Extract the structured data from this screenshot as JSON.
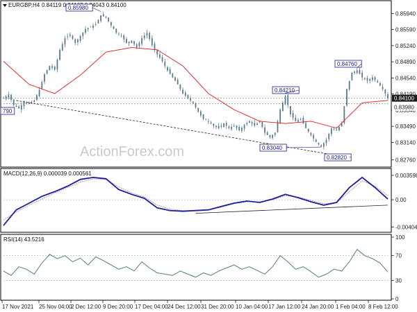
{
  "header": {
    "symbol_label": "EURGBP,H4",
    "ohlc_label": "0.84119 0.84162 0.84043 0.84100"
  },
  "watermark": "ActionForex.com",
  "colors": {
    "candle": "#5a7a8c",
    "ma": "#e03030",
    "macd": "#1e1e9c",
    "signal": "#9a9a9a",
    "rsi": "#5a7a8c",
    "callout_border": "#1a1a8c",
    "current_price_bg": "#1a1a1a",
    "trendline": "#222222"
  },
  "price_axis_labels": [
    "0.85940",
    "0.85590",
    "0.85240",
    "0.84890",
    "0.84540",
    "0.84190",
    "0.83840",
    "0.83490",
    "0.83140",
    "0.82760"
  ],
  "macd_axis_labels": [
    "0.003598",
    "0.00",
    "-0.00404"
  ],
  "rsi_axis_labels": [
    "100",
    "70",
    "30",
    "0"
  ],
  "time_labels": [
    "17 Nov 2021",
    "25 Nov 04:00",
    "2 Dec 12:00",
    "9 Dec 20:00",
    "17 Dec 04:00",
    "24 Dec 12:00",
    "31 Dec 20:00",
    "10 Jan 04:00",
    "17 Jan 12:00",
    "24 Jan 20:00",
    "1 Feb 04:00",
    "8 Feb 12:00"
  ],
  "macd_title": "MACD(12,26,9) 0.000039 0.000561",
  "rsi_title": "RSI(14) 43.5216",
  "chart_data": [
    {
      "type": "candlestick",
      "title": "EURGBP,H4",
      "ylim": [
        0.8265,
        0.8605
      ],
      "y_ticks": [
        0.8594,
        0.8559,
        0.8524,
        0.8489,
        0.8454,
        0.8419,
        0.8384,
        0.8349,
        0.8314,
        0.8276
      ],
      "current_price": "0.84100",
      "previous_level": "0.83980",
      "annotations": [
        {
          "label": "0.85980",
          "value": 0.8598
        },
        {
          "label": "0.84210",
          "value": 0.8421
        },
        {
          "label": "0.84760",
          "value": 0.8476
        },
        {
          "label": "0.83040",
          "value": 0.8304
        },
        {
          "label": "0.82820",
          "value": 0.8282
        },
        {
          "label": "790",
          "value": 0.8379
        }
      ],
      "close_path": [
        [
          0,
          0.841
        ],
        [
          4,
          0.8418
        ],
        [
          8,
          0.8395
        ],
        [
          12,
          0.8388
        ],
        [
          16,
          0.8402
        ],
        [
          20,
          0.8398
        ],
        [
          24,
          0.8405
        ],
        [
          28,
          0.8428
        ],
        [
          32,
          0.8462
        ],
        [
          36,
          0.848
        ],
        [
          40,
          0.8472
        ],
        [
          44,
          0.8515
        ],
        [
          48,
          0.854
        ],
        [
          52,
          0.8548
        ],
        [
          56,
          0.853
        ],
        [
          60,
          0.8545
        ],
        [
          64,
          0.856
        ],
        [
          68,
          0.8565
        ],
        [
          72,
          0.857
        ],
        [
          76,
          0.859
        ],
        [
          80,
          0.8585
        ],
        [
          84,
          0.8568
        ],
        [
          88,
          0.8552
        ],
        [
          92,
          0.8545
        ],
        [
          96,
          0.853
        ],
        [
          100,
          0.8535
        ],
        [
          104,
          0.852
        ],
        [
          108,
          0.854
        ],
        [
          112,
          0.8552
        ],
        [
          116,
          0.8525
        ],
        [
          120,
          0.8505
        ],
        [
          124,
          0.849
        ],
        [
          128,
          0.847
        ],
        [
          132,
          0.8455
        ],
        [
          136,
          0.844
        ],
        [
          140,
          0.842
        ],
        [
          144,
          0.841
        ],
        [
          148,
          0.84
        ],
        [
          152,
          0.838
        ],
        [
          156,
          0.8365
        ],
        [
          160,
          0.836
        ],
        [
          164,
          0.835
        ],
        [
          168,
          0.8345
        ],
        [
          172,
          0.8355
        ],
        [
          176,
          0.8345
        ],
        [
          180,
          0.835
        ],
        [
          184,
          0.834
        ],
        [
          188,
          0.8352
        ],
        [
          192,
          0.836
        ],
        [
          196,
          0.835
        ],
        [
          200,
          0.836
        ],
        [
          204,
          0.8335
        ],
        [
          208,
          0.8325
        ],
        [
          212,
          0.8335
        ],
        [
          216,
          0.8385
        ],
        [
          220,
          0.8415
        ],
        [
          224,
          0.8375
        ],
        [
          228,
          0.836
        ],
        [
          232,
          0.8365
        ],
        [
          236,
          0.8345
        ],
        [
          240,
          0.833
        ],
        [
          244,
          0.8315
        ],
        [
          248,
          0.8305
        ],
        [
          252,
          0.832
        ],
        [
          256,
          0.8345
        ],
        [
          260,
          0.834
        ],
        [
          264,
          0.8355
        ],
        [
          268,
          0.843
        ],
        [
          272,
          0.8465
        ],
        [
          276,
          0.847
        ],
        [
          280,
          0.8455
        ],
        [
          284,
          0.8448
        ],
        [
          288,
          0.8455
        ],
        [
          292,
          0.8445
        ],
        [
          296,
          0.843
        ],
        [
          300,
          0.841
        ]
      ],
      "ma_path": [
        [
          0,
          0.849
        ],
        [
          20,
          0.844
        ],
        [
          40,
          0.842
        ],
        [
          60,
          0.846
        ],
        [
          80,
          0.851
        ],
        [
          100,
          0.852
        ],
        [
          120,
          0.8515
        ],
        [
          140,
          0.848
        ],
        [
          160,
          0.842
        ],
        [
          180,
          0.8385
        ],
        [
          200,
          0.836
        ],
        [
          220,
          0.8355
        ],
        [
          240,
          0.836
        ],
        [
          260,
          0.8345
        ],
        [
          280,
          0.84
        ],
        [
          300,
          0.8405
        ]
      ]
    },
    {
      "type": "line",
      "title": "MACD(12,26,9) 0.000039 0.000561",
      "ylim": [
        -0.0045,
        0.0039
      ],
      "y_ticks": [
        0.003598,
        0.0,
        -0.00404
      ],
      "series": [
        {
          "name": "MACD",
          "values": [
            [
              0,
              -0.0038
            ],
            [
              10,
              -0.0015
            ],
            [
              20,
              -0.0005
            ],
            [
              30,
              0.0005
            ],
            [
              40,
              0.0012
            ],
            [
              50,
              0.002
            ],
            [
              60,
              0.003
            ],
            [
              70,
              0.0033
            ],
            [
              80,
              0.0031
            ],
            [
              90,
              0.0015
            ],
            [
              100,
              0.0008
            ],
            [
              110,
              0.0002
            ],
            [
              120,
              -0.0012
            ],
            [
              130,
              -0.0016
            ],
            [
              140,
              -0.0017
            ],
            [
              150,
              -0.0016
            ],
            [
              160,
              -0.0015
            ],
            [
              170,
              -0.001
            ],
            [
              180,
              -0.0005
            ],
            [
              190,
              -0.0002
            ],
            [
              200,
              -0.0004
            ],
            [
              210,
              0.0001
            ],
            [
              220,
              0.0008
            ],
            [
              230,
              0.0003
            ],
            [
              240,
              -0.0003
            ],
            [
              250,
              -0.0008
            ],
            [
              260,
              -0.0004
            ],
            [
              270,
              0.0018
            ],
            [
              280,
              0.0033
            ],
            [
              290,
              0.0018
            ],
            [
              300,
              0.0001
            ]
          ]
        },
        {
          "name": "Signal",
          "values": [
            [
              0,
              -0.003
            ],
            [
              10,
              -0.0018
            ],
            [
              20,
              -0.0008
            ],
            [
              30,
              0.0001
            ],
            [
              40,
              0.001
            ],
            [
              50,
              0.0018
            ],
            [
              60,
              0.0026
            ],
            [
              70,
              0.0031
            ],
            [
              80,
              0.003
            ],
            [
              90,
              0.0019
            ],
            [
              100,
              0.001
            ],
            [
              110,
              0.0004
            ],
            [
              120,
              -0.0008
            ],
            [
              130,
              -0.0014
            ],
            [
              140,
              -0.0016
            ],
            [
              150,
              -0.0016
            ],
            [
              160,
              -0.0015
            ],
            [
              170,
              -0.0011
            ],
            [
              180,
              -0.0006
            ],
            [
              190,
              -0.0003
            ],
            [
              200,
              -0.0003
            ],
            [
              210,
              0.0
            ],
            [
              220,
              0.0006
            ],
            [
              230,
              0.0004
            ],
            [
              240,
              -0.0001
            ],
            [
              250,
              -0.0006
            ],
            [
              260,
              -0.0004
            ],
            [
              270,
              0.0012
            ],
            [
              280,
              0.0028
            ],
            [
              290,
              0.002
            ],
            [
              300,
              0.0006
            ]
          ]
        }
      ],
      "trendline": [
        [
          150,
          -0.002
        ],
        [
          300,
          -0.0008
        ]
      ]
    },
    {
      "type": "line",
      "title": "RSI(14) 43.5216",
      "ylim": [
        0,
        100
      ],
      "y_ticks": [
        100,
        70,
        30,
        0
      ],
      "series": [
        {
          "name": "RSI",
          "values": [
            [
              0,
              45
            ],
            [
              6,
              38
            ],
            [
              12,
              52
            ],
            [
              18,
              48
            ],
            [
              24,
              40
            ],
            [
              30,
              58
            ],
            [
              36,
              72
            ],
            [
              42,
              65
            ],
            [
              48,
              70
            ],
            [
              54,
              60
            ],
            [
              60,
              66
            ],
            [
              66,
              55
            ],
            [
              72,
              68
            ],
            [
              78,
              62
            ],
            [
              84,
              55
            ],
            [
              90,
              48
            ],
            [
              96,
              52
            ],
            [
              102,
              45
            ],
            [
              108,
              60
            ],
            [
              114,
              50
            ],
            [
              120,
              42
            ],
            [
              126,
              40
            ],
            [
              132,
              38
            ],
            [
              138,
              45
            ],
            [
              144,
              40
            ],
            [
              150,
              35
            ],
            [
              156,
              42
            ],
            [
              162,
              38
            ],
            [
              168,
              45
            ],
            [
              174,
              50
            ],
            [
              180,
              55
            ],
            [
              186,
              48
            ],
            [
              192,
              52
            ],
            [
              198,
              46
            ],
            [
              204,
              40
            ],
            [
              210,
              52
            ],
            [
              216,
              70
            ],
            [
              222,
              60
            ],
            [
              228,
              48
            ],
            [
              234,
              52
            ],
            [
              240,
              44
            ],
            [
              246,
              35
            ],
            [
              252,
              40
            ],
            [
              258,
              48
            ],
            [
              264,
              45
            ],
            [
              270,
              60
            ],
            [
              276,
              80
            ],
            [
              282,
              70
            ],
            [
              288,
              65
            ],
            [
              294,
              58
            ],
            [
              300,
              43.5
            ]
          ]
        }
      ]
    }
  ]
}
